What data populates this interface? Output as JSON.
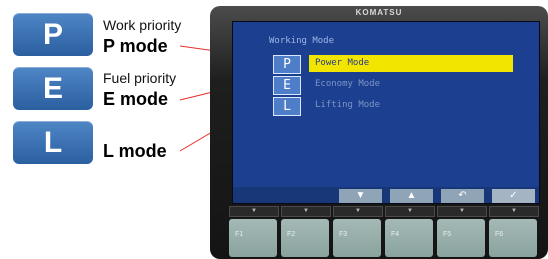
{
  "legend": {
    "items": [
      {
        "key": "P",
        "caption": "Work priority",
        "mode": "P mode"
      },
      {
        "key": "E",
        "caption": "Fuel priority",
        "mode": "E mode"
      },
      {
        "key": "L",
        "caption": "",
        "mode": "L mode"
      }
    ]
  },
  "monitor": {
    "brand": "KOMATSU",
    "screen": {
      "title": "Working Mode",
      "options": [
        {
          "key": "P",
          "label": "Power Mode",
          "selected": true
        },
        {
          "key": "E",
          "label": "Economy Mode",
          "selected": false
        },
        {
          "key": "L",
          "label": "Lifting Mode",
          "selected": false
        }
      ],
      "softkeys": [
        "▼",
        "▲",
        "↶",
        "✓"
      ]
    },
    "function_keys": [
      "F1",
      "F2",
      "F3",
      "F4",
      "F5",
      "F6"
    ],
    "function_key_tab_glyph": "▼"
  },
  "colors": {
    "badge": "#3b72b6",
    "screen_bg": "#1d3f8f",
    "selected_highlight": "#f2e600",
    "function_key": "#9ab0ac"
  }
}
